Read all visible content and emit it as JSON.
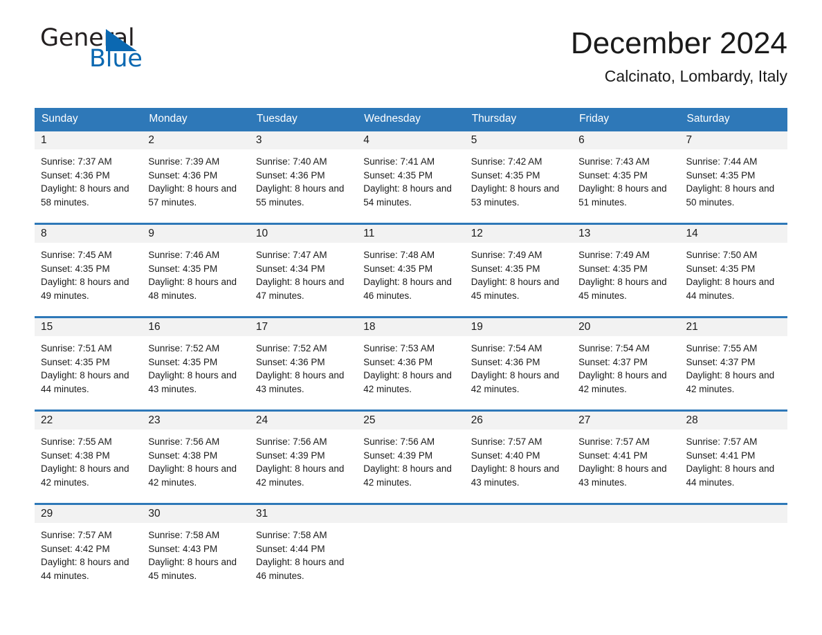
{
  "brand": {
    "name_part1": "General",
    "name_part2": "Blue",
    "triangle_icon": "triangle-icon",
    "accent_color": "#0b68b1"
  },
  "header": {
    "month_title": "December 2024",
    "location": "Calcinato, Lombardy, Italy"
  },
  "calendar": {
    "header_color": "#2e78b8",
    "date_strip_color": "#f2f2f2",
    "weekdays": [
      "Sunday",
      "Monday",
      "Tuesday",
      "Wednesday",
      "Thursday",
      "Friday",
      "Saturday"
    ],
    "weeks": [
      [
        {
          "date": "1",
          "sunrise": "Sunrise: 7:37 AM",
          "sunset": "Sunset: 4:36 PM",
          "daylight": "Daylight: 8 hours and 58 minutes."
        },
        {
          "date": "2",
          "sunrise": "Sunrise: 7:39 AM",
          "sunset": "Sunset: 4:36 PM",
          "daylight": "Daylight: 8 hours and 57 minutes."
        },
        {
          "date": "3",
          "sunrise": "Sunrise: 7:40 AM",
          "sunset": "Sunset: 4:36 PM",
          "daylight": "Daylight: 8 hours and 55 minutes."
        },
        {
          "date": "4",
          "sunrise": "Sunrise: 7:41 AM",
          "sunset": "Sunset: 4:35 PM",
          "daylight": "Daylight: 8 hours and 54 minutes."
        },
        {
          "date": "5",
          "sunrise": "Sunrise: 7:42 AM",
          "sunset": "Sunset: 4:35 PM",
          "daylight": "Daylight: 8 hours and 53 minutes."
        },
        {
          "date": "6",
          "sunrise": "Sunrise: 7:43 AM",
          "sunset": "Sunset: 4:35 PM",
          "daylight": "Daylight: 8 hours and 51 minutes."
        },
        {
          "date": "7",
          "sunrise": "Sunrise: 7:44 AM",
          "sunset": "Sunset: 4:35 PM",
          "daylight": "Daylight: 8 hours and 50 minutes."
        }
      ],
      [
        {
          "date": "8",
          "sunrise": "Sunrise: 7:45 AM",
          "sunset": "Sunset: 4:35 PM",
          "daylight": "Daylight: 8 hours and 49 minutes."
        },
        {
          "date": "9",
          "sunrise": "Sunrise: 7:46 AM",
          "sunset": "Sunset: 4:35 PM",
          "daylight": "Daylight: 8 hours and 48 minutes."
        },
        {
          "date": "10",
          "sunrise": "Sunrise: 7:47 AM",
          "sunset": "Sunset: 4:34 PM",
          "daylight": "Daylight: 8 hours and 47 minutes."
        },
        {
          "date": "11",
          "sunrise": "Sunrise: 7:48 AM",
          "sunset": "Sunset: 4:35 PM",
          "daylight": "Daylight: 8 hours and 46 minutes."
        },
        {
          "date": "12",
          "sunrise": "Sunrise: 7:49 AM",
          "sunset": "Sunset: 4:35 PM",
          "daylight": "Daylight: 8 hours and 45 minutes."
        },
        {
          "date": "13",
          "sunrise": "Sunrise: 7:49 AM",
          "sunset": "Sunset: 4:35 PM",
          "daylight": "Daylight: 8 hours and 45 minutes."
        },
        {
          "date": "14",
          "sunrise": "Sunrise: 7:50 AM",
          "sunset": "Sunset: 4:35 PM",
          "daylight": "Daylight: 8 hours and 44 minutes."
        }
      ],
      [
        {
          "date": "15",
          "sunrise": "Sunrise: 7:51 AM",
          "sunset": "Sunset: 4:35 PM",
          "daylight": "Daylight: 8 hours and 44 minutes."
        },
        {
          "date": "16",
          "sunrise": "Sunrise: 7:52 AM",
          "sunset": "Sunset: 4:35 PM",
          "daylight": "Daylight: 8 hours and 43 minutes."
        },
        {
          "date": "17",
          "sunrise": "Sunrise: 7:52 AM",
          "sunset": "Sunset: 4:36 PM",
          "daylight": "Daylight: 8 hours and 43 minutes."
        },
        {
          "date": "18",
          "sunrise": "Sunrise: 7:53 AM",
          "sunset": "Sunset: 4:36 PM",
          "daylight": "Daylight: 8 hours and 42 minutes."
        },
        {
          "date": "19",
          "sunrise": "Sunrise: 7:54 AM",
          "sunset": "Sunset: 4:36 PM",
          "daylight": "Daylight: 8 hours and 42 minutes."
        },
        {
          "date": "20",
          "sunrise": "Sunrise: 7:54 AM",
          "sunset": "Sunset: 4:37 PM",
          "daylight": "Daylight: 8 hours and 42 minutes."
        },
        {
          "date": "21",
          "sunrise": "Sunrise: 7:55 AM",
          "sunset": "Sunset: 4:37 PM",
          "daylight": "Daylight: 8 hours and 42 minutes."
        }
      ],
      [
        {
          "date": "22",
          "sunrise": "Sunrise: 7:55 AM",
          "sunset": "Sunset: 4:38 PM",
          "daylight": "Daylight: 8 hours and 42 minutes."
        },
        {
          "date": "23",
          "sunrise": "Sunrise: 7:56 AM",
          "sunset": "Sunset: 4:38 PM",
          "daylight": "Daylight: 8 hours and 42 minutes."
        },
        {
          "date": "24",
          "sunrise": "Sunrise: 7:56 AM",
          "sunset": "Sunset: 4:39 PM",
          "daylight": "Daylight: 8 hours and 42 minutes."
        },
        {
          "date": "25",
          "sunrise": "Sunrise: 7:56 AM",
          "sunset": "Sunset: 4:39 PM",
          "daylight": "Daylight: 8 hours and 42 minutes."
        },
        {
          "date": "26",
          "sunrise": "Sunrise: 7:57 AM",
          "sunset": "Sunset: 4:40 PM",
          "daylight": "Daylight: 8 hours and 43 minutes."
        },
        {
          "date": "27",
          "sunrise": "Sunrise: 7:57 AM",
          "sunset": "Sunset: 4:41 PM",
          "daylight": "Daylight: 8 hours and 43 minutes."
        },
        {
          "date": "28",
          "sunrise": "Sunrise: 7:57 AM",
          "sunset": "Sunset: 4:41 PM",
          "daylight": "Daylight: 8 hours and 44 minutes."
        }
      ],
      [
        {
          "date": "29",
          "sunrise": "Sunrise: 7:57 AM",
          "sunset": "Sunset: 4:42 PM",
          "daylight": "Daylight: 8 hours and 44 minutes."
        },
        {
          "date": "30",
          "sunrise": "Sunrise: 7:58 AM",
          "sunset": "Sunset: 4:43 PM",
          "daylight": "Daylight: 8 hours and 45 minutes."
        },
        {
          "date": "31",
          "sunrise": "Sunrise: 7:58 AM",
          "sunset": "Sunset: 4:44 PM",
          "daylight": "Daylight: 8 hours and 46 minutes."
        },
        {
          "date": "",
          "sunrise": "",
          "sunset": "",
          "daylight": ""
        },
        {
          "date": "",
          "sunrise": "",
          "sunset": "",
          "daylight": ""
        },
        {
          "date": "",
          "sunrise": "",
          "sunset": "",
          "daylight": ""
        },
        {
          "date": "",
          "sunrise": "",
          "sunset": "",
          "daylight": ""
        }
      ]
    ]
  }
}
